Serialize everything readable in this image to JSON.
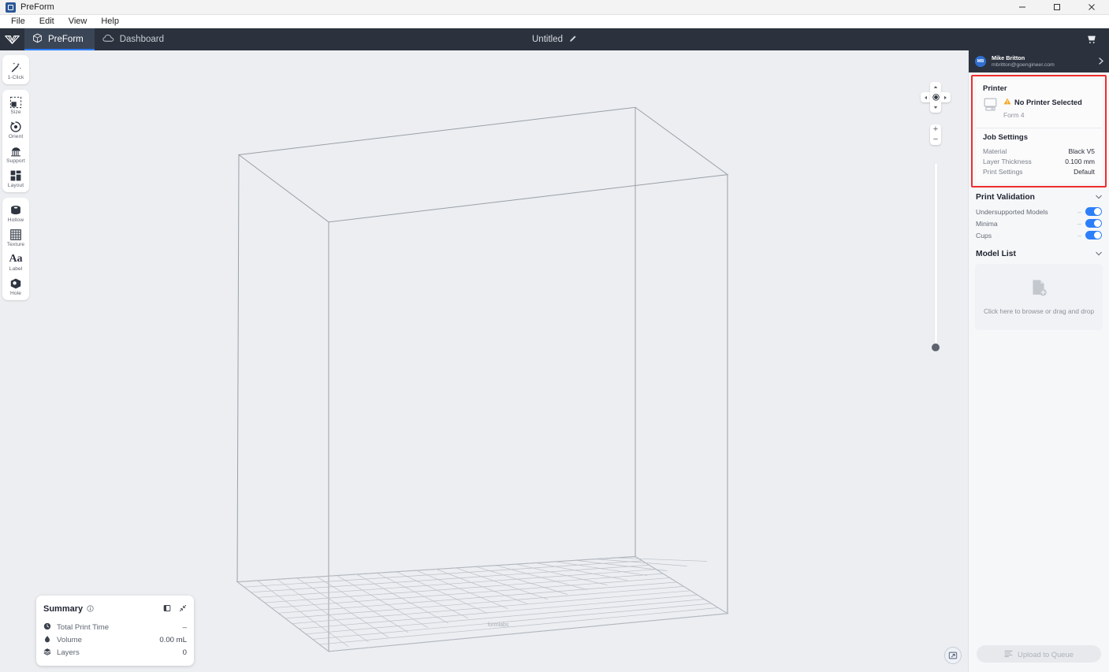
{
  "window": {
    "app_title": "PreForm",
    "minimize_label": "Minimize",
    "maximize_label": "Maximize",
    "close_label": "Close"
  },
  "menubar": {
    "items": [
      "File",
      "Edit",
      "View",
      "Help"
    ]
  },
  "header": {
    "tabs": [
      {
        "label": "PreForm",
        "icon": "cube-icon",
        "active": true
      },
      {
        "label": "Dashboard",
        "icon": "cloud-icon",
        "active": false
      }
    ],
    "document_title": "Untitled",
    "edit_icon": "pencil-icon",
    "cart_icon": "shopping-cart-icon"
  },
  "toolbar": {
    "groups": [
      {
        "tools": [
          {
            "label": "1-Click",
            "icon": "magic-wand-icon"
          }
        ]
      },
      {
        "tools": [
          {
            "label": "Size",
            "icon": "scale-icon"
          },
          {
            "label": "Orient",
            "icon": "rotate-icon"
          },
          {
            "label": "Support",
            "icon": "support-icon"
          },
          {
            "label": "Layout",
            "icon": "layout-grid-icon"
          }
        ]
      },
      {
        "tools": [
          {
            "label": "Hollow",
            "icon": "hollow-cylinder-icon"
          },
          {
            "label": "Texture",
            "icon": "texture-grid-icon"
          },
          {
            "label": "Label",
            "icon": "text-label-icon"
          },
          {
            "label": "Hole",
            "icon": "hole-cube-icon"
          }
        ]
      }
    ]
  },
  "viewport": {
    "platform_logo_text": "formlabs",
    "nav": {
      "pan_up": "pan-up",
      "pan_down": "pan-down",
      "pan_left": "pan-left",
      "pan_right": "pan-right",
      "recenter": "recenter",
      "zoom_in": "+",
      "zoom_out": "−"
    },
    "zoom_slider_value": 0,
    "fit_view_icon": "fit-to-view-icon"
  },
  "summary": {
    "title": "Summary",
    "info_icon": "info-icon",
    "panel_icon": "panel-toggle-icon",
    "collapse_icon": "collapse-icon",
    "rows": [
      {
        "icon": "clock-icon",
        "label": "Total Print Time",
        "value": "–"
      },
      {
        "icon": "volume-icon",
        "label": "Volume",
        "value": "0.00 mL"
      },
      {
        "icon": "layers-icon",
        "label": "Layers",
        "value": "0"
      }
    ]
  },
  "account": {
    "initials": "MB",
    "name": "Mike Britton",
    "email": "mbritton@goengineer.com",
    "chevron_icon": "chevron-right-icon"
  },
  "printer_card": {
    "highlight_color": "#ef2d2d",
    "printer_section_title": "Printer",
    "printer_icon": "printer-icon",
    "warning_icon": "warning-triangle-icon",
    "warning_color": "#f5a623",
    "status_text": "No Printer Selected",
    "model_text": "Form 4",
    "job_section_title": "Job Settings",
    "job_rows": [
      {
        "label": "Material",
        "value": "Black V5"
      },
      {
        "label": "Layer Thickness",
        "value": "0.100 mm"
      },
      {
        "label": "Print Settings",
        "value": "Default"
      }
    ]
  },
  "print_validation": {
    "title": "Print Validation",
    "caret_icon": "caret-down-icon",
    "toggle_color": "#2d7ff9",
    "rows": [
      {
        "label": "Undersupported Models",
        "enabled": true
      },
      {
        "label": "Minima",
        "enabled": true
      },
      {
        "label": "Cups",
        "enabled": true
      }
    ]
  },
  "model_list": {
    "title": "Model List",
    "caret_icon": "caret-down-icon",
    "dropzone_icon": "file-add-icon",
    "dropzone_text": "Click here to browse or drag and drop"
  },
  "footer": {
    "upload_label": "Upload to Queue",
    "upload_icon": "queue-icon",
    "upload_enabled": false
  }
}
